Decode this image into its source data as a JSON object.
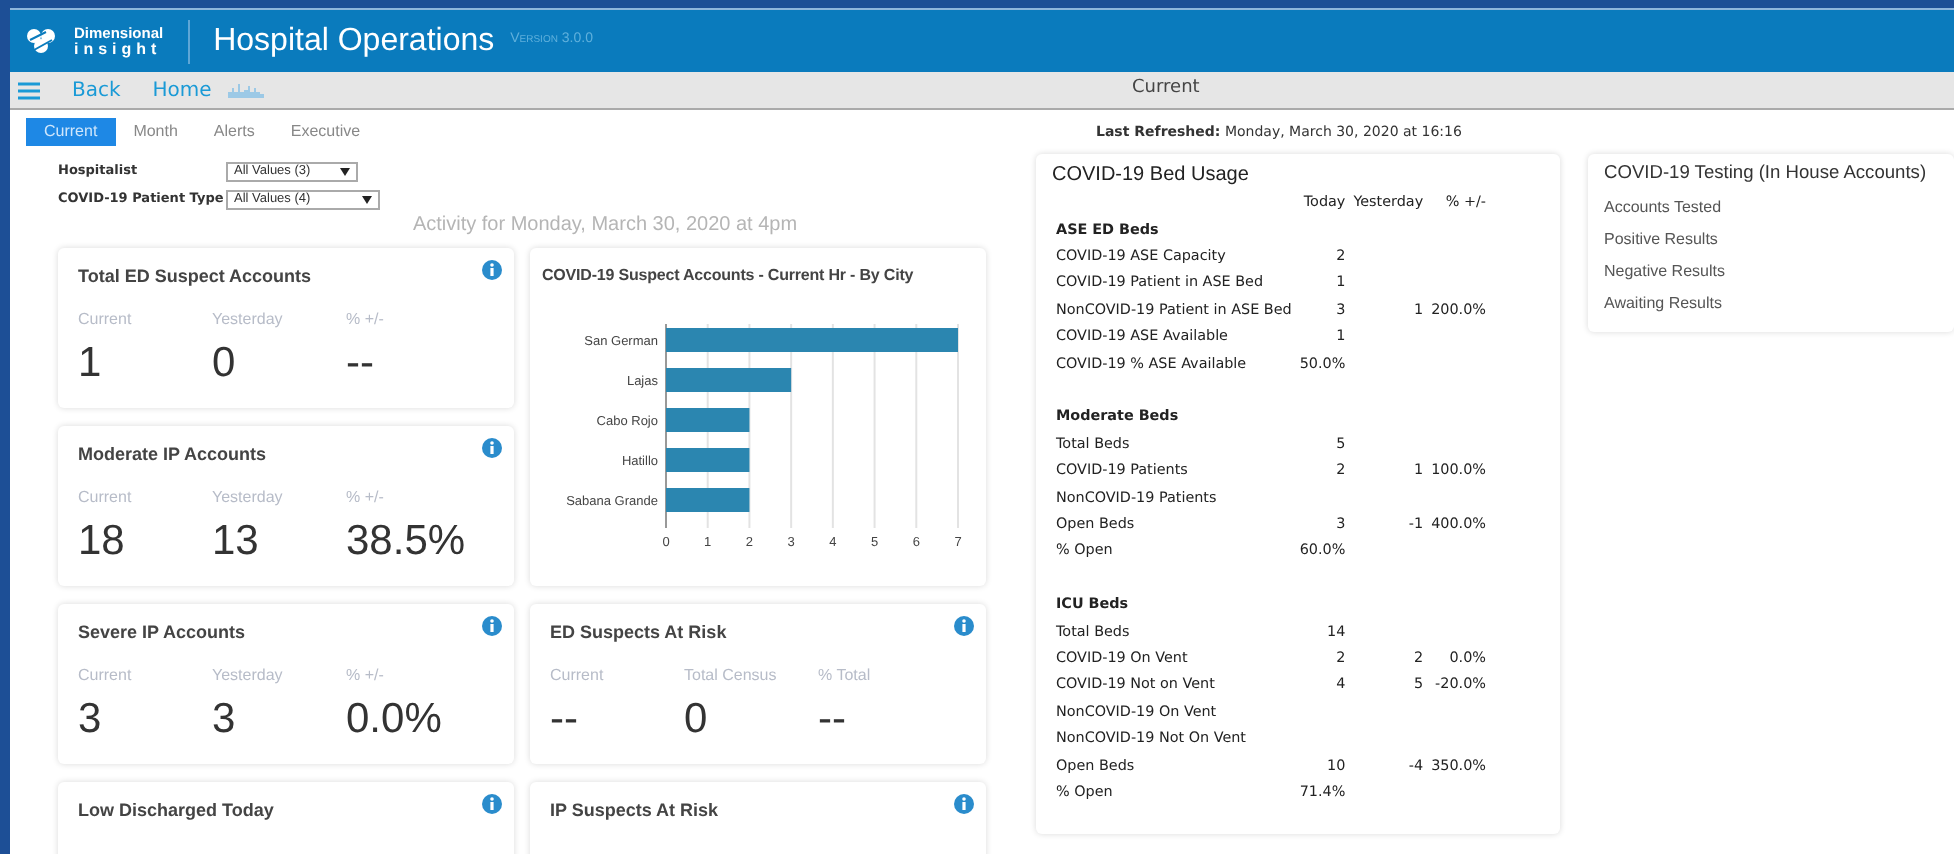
{
  "header": {
    "logo": {
      "line_1": "Dimensional",
      "line_2": "insight"
    },
    "title": "Hospital Operations",
    "version": "Version 3.0.0"
  },
  "navbar": {
    "back": "Back",
    "home": "Home",
    "page": "Current"
  },
  "tabs": [
    {
      "label": "Current",
      "selected": true
    },
    {
      "label": "Month",
      "selected": false
    },
    {
      "label": "Alerts",
      "selected": false
    },
    {
      "label": "Executive",
      "selected": false
    }
  ],
  "last_refreshed": {
    "label": "Last Refreshed:",
    "value": "Monday, March 30, 2020 at 16:16"
  },
  "filters": [
    {
      "label": "Hospitalist",
      "value": "All Values (3)"
    },
    {
      "label": "COVID-19 Patient Type",
      "value": "All Values (4)"
    }
  ],
  "activity_heading": "Activity for Monday, March 30, 2020 at 4pm",
  "column_1": [
    {
      "kind": "stat",
      "title": "Total ED Suspect Accounts",
      "metrics": [
        {
          "label": "Current",
          "value": "1"
        },
        {
          "label": "Yesterday",
          "value": "0"
        },
        {
          "label": "% +/-",
          "value": "--"
        }
      ]
    },
    {
      "kind": "stat",
      "title": "Moderate IP Accounts",
      "metrics": [
        {
          "label": "Current",
          "value": "18"
        },
        {
          "label": "Yesterday",
          "value": "13"
        },
        {
          "label": "% +/-",
          "value": "38.5%"
        }
      ]
    },
    {
      "kind": "stat",
      "title": "Severe IP Accounts",
      "metrics": [
        {
          "label": "Current",
          "value": "3"
        },
        {
          "label": "Yesterday",
          "value": "3"
        },
        {
          "label": "% +/-",
          "value": "0.0%"
        }
      ]
    },
    {
      "kind": "stat",
      "title": "Low Discharged Today"
    }
  ],
  "column_2": [
    {
      "kind": "chart",
      "title": "COVID-19 Suspect Accounts - Current Hr - By City",
      "chart_data": {
        "type": "bar",
        "orientation": "horizontal",
        "categories": [
          "San German",
          "Lajas",
          "Cabo Rojo",
          "Hatillo",
          "Sabana Grande"
        ],
        "series": [
          {
            "color": "#2b86b0",
            "values": [
              7,
              3,
              2,
              2,
              2
            ]
          }
        ],
        "xlim": [
          0,
          7
        ],
        "xticks": [
          0,
          1,
          2,
          3,
          4,
          5,
          6,
          7
        ],
        "grid": true
      }
    },
    {
      "kind": "stat",
      "title": "ED Suspects At Risk",
      "metrics": [
        {
          "label": "Current",
          "value": "--"
        },
        {
          "label": "Total Census",
          "value": "0"
        },
        {
          "label": "% Total",
          "value": "--"
        }
      ]
    },
    {
      "kind": "stat",
      "title": "IP Suspects At Risk"
    }
  ],
  "bed_usage": {
    "title": "COVID-19 Bed Usage",
    "columns": [
      "Today",
      "Yesterday",
      "% +/-"
    ],
    "sections": [
      {
        "heading": "ASE ED Beds",
        "rows": [
          {
            "label": "COVID-19 ASE Capacity",
            "today": "2"
          },
          {
            "label": "COVID-19 Patient in ASE Bed",
            "today": "1"
          },
          {
            "label": "NonCOVID-19 Patient in ASE Bed",
            "today": "3",
            "yesterday": "1",
            "change": "200.0%"
          },
          {
            "label": "COVID-19 ASE Available",
            "today": "1"
          },
          {
            "label": "COVID-19 % ASE Available",
            "today": "50.0%"
          }
        ]
      },
      {
        "heading": "Moderate Beds",
        "rows": [
          {
            "label": "Total Beds",
            "today": "5"
          },
          {
            "label": "COVID-19 Patients",
            "today": "2",
            "yesterday": "1",
            "change": "100.0%"
          },
          {
            "label": "NonCOVID-19 Patients"
          },
          {
            "label": "Open Beds",
            "today": "3",
            "yesterday": "-1",
            "change": "400.0%"
          },
          {
            "label": "% Open",
            "today": "60.0%"
          }
        ]
      },
      {
        "heading": "ICU Beds",
        "rows": [
          {
            "label": "Total Beds",
            "today": "14"
          },
          {
            "label": "COVID-19 On Vent",
            "today": "2",
            "yesterday": "2",
            "change": "0.0%"
          },
          {
            "label": "COVID-19 Not on Vent",
            "today": "4",
            "yesterday": "5",
            "change": "-20.0%"
          },
          {
            "label": "NonCOVID-19 On Vent"
          },
          {
            "label": "NonCOVID-19 Not On Vent"
          },
          {
            "label": "Open Beds",
            "today": "10",
            "yesterday": "-4",
            "change": "350.0%"
          },
          {
            "label": "% Open",
            "today": "71.4%"
          }
        ]
      }
    ]
  },
  "testing": {
    "title": "COVID-19 Testing (In House Accounts)",
    "items": [
      "Accounts Tested",
      "Positive Results",
      "Negative Results",
      "Awaiting Results"
    ]
  }
}
